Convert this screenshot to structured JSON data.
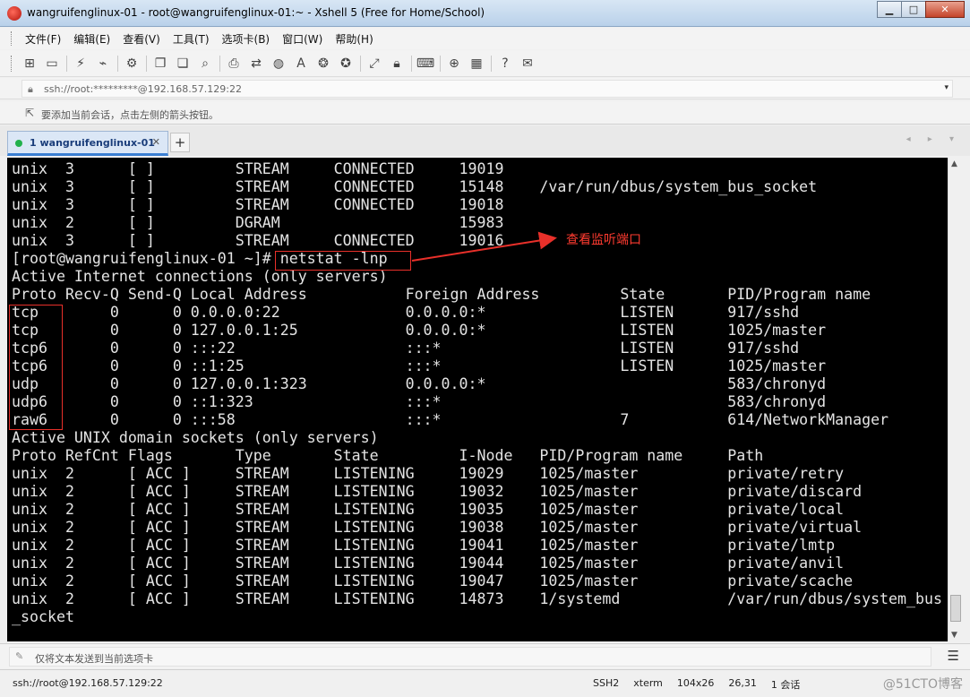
{
  "window": {
    "title": "wangruifenglinux-01 - root@wangruifenglinux-01:~ - Xshell 5 (Free for Home/School)",
    "minimize": "▁",
    "maximize": "□",
    "close": "✕"
  },
  "menu": [
    "文件(F)",
    "编辑(E)",
    "查看(V)",
    "工具(T)",
    "选项卡(B)",
    "窗口(W)",
    "帮助(H)"
  ],
  "toolbar": {
    "icons": [
      "new-session-icon",
      "open-folder-icon",
      "connect-icon",
      "disconnect-icon",
      "properties-icon",
      "copy-icon",
      "paste-icon",
      "find-icon",
      "print-icon",
      "transfer-icon",
      "globe-icon",
      "font-icon",
      "xftp-icon",
      "xmanager-icon",
      "fullscreen-icon",
      "lock-icon",
      "keyboard-icon",
      "add-icon",
      "layout-icon",
      "help-icon",
      "chat-icon"
    ]
  },
  "address": {
    "value": "ssh://root:*********@192.168.57.129:22",
    "dropdown": "▾"
  },
  "hint": {
    "text": "要添加当前会话，点击左侧的箭头按钮。"
  },
  "tabs": [
    {
      "label": "1 wangruifenglinux-01",
      "close": "✕",
      "status_color": "#22b14c"
    }
  ],
  "tab_add": "+",
  "tab_nav": "◂ ▸ ▾",
  "terminal": {
    "lines": [
      "unix  3      [ ]         STREAM     CONNECTED     19019",
      "unix  3      [ ]         STREAM     CONNECTED     15148    /var/run/dbus/system_bus_socket",
      "unix  3      [ ]         STREAM     CONNECTED     19018",
      "unix  2      [ ]         DGRAM                    15983",
      "unix  3      [ ]         STREAM     CONNECTED     19016",
      "[root@wangruifenglinux-01 ~]# netstat -lnp",
      "Active Internet connections (only servers)",
      "Proto Recv-Q Send-Q Local Address           Foreign Address         State       PID/Program name",
      "tcp        0      0 0.0.0.0:22              0.0.0.0:*               LISTEN      917/sshd",
      "tcp        0      0 127.0.0.1:25            0.0.0.0:*               LISTEN      1025/master",
      "tcp6       0      0 :::22                   :::*                    LISTEN      917/sshd",
      "tcp6       0      0 ::1:25                  :::*                    LISTEN      1025/master",
      "udp        0      0 127.0.0.1:323           0.0.0.0:*                           583/chronyd",
      "udp6       0      0 ::1:323                 :::*                                583/chronyd",
      "raw6       0      0 :::58                   :::*                    7           614/NetworkManager",
      "Active UNIX domain sockets (only servers)",
      "Proto RefCnt Flags       Type       State         I-Node   PID/Program name     Path",
      "unix  2      [ ACC ]     STREAM     LISTENING     19029    1025/master          private/retry",
      "unix  2      [ ACC ]     STREAM     LISTENING     19032    1025/master          private/discard",
      "unix  2      [ ACC ]     STREAM     LISTENING     19035    1025/master          private/local",
      "unix  2      [ ACC ]     STREAM     LISTENING     19038    1025/master          private/virtual",
      "unix  2      [ ACC ]     STREAM     LISTENING     19041    1025/master          private/lmtp",
      "unix  2      [ ACC ]     STREAM     LISTENING     19044    1025/master          private/anvil",
      "unix  2      [ ACC ]     STREAM     LISTENING     19047    1025/master          private/scache",
      "unix  2      [ ACC ]     STREAM     LISTENING     14873    1/systemd            /var/run/dbus/system_bus",
      "_socket"
    ],
    "text_color": "#e4e4e4",
    "background": "#000000"
  },
  "annotation": {
    "text": "查看监听端口",
    "color": "#ff3b30"
  },
  "input_bar": {
    "placeholder": "仅将文本发送到当前选项卡",
    "menu_icon": "☰"
  },
  "status": {
    "connection": "ssh://root@192.168.57.129:22",
    "items": [
      "SSH2",
      "xterm",
      "104x26",
      "26,31",
      "1 会话"
    ],
    "watermark": "@51CTO博客"
  }
}
